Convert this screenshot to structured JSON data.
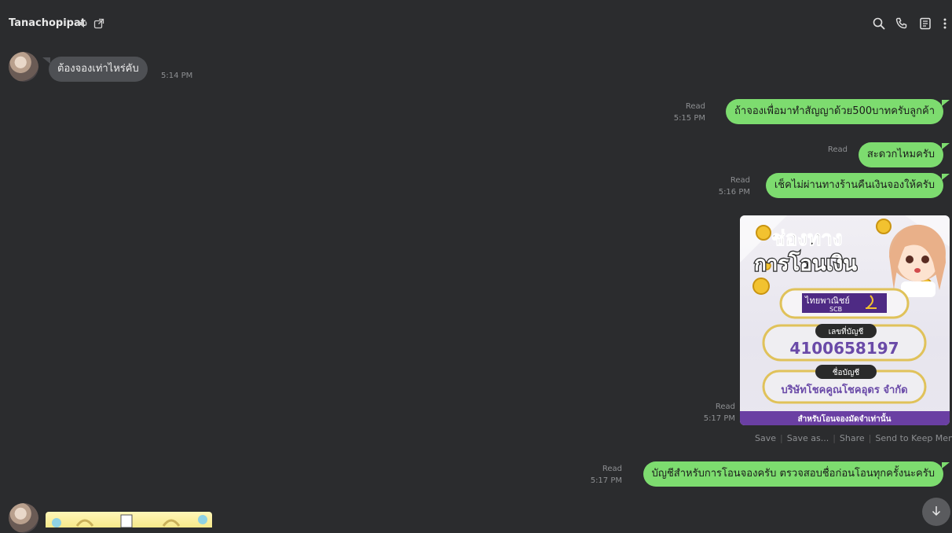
{
  "header": {
    "title": "Tanachopipat"
  },
  "messages": {
    "m1": {
      "text": "ต้องจองเท่าไหร่คับ",
      "time": "5:14 PM"
    },
    "m2": {
      "text": "ถ้าจองเพื่อมาทำสัญญาด้วย500บาทครับลูกค้า",
      "read": "Read",
      "time": "5:15 PM"
    },
    "m3": {
      "text": "สะดวกไหมครับ",
      "read": "Read"
    },
    "m4": {
      "text": "เช็คไม่ผ่านทางร้านคืนเงินจองให้ครับ",
      "read": "Read",
      "time": "5:16 PM"
    },
    "m5": {
      "read": "Read",
      "time": "5:17 PM"
    },
    "m6": {
      "text": "บัญชีสำหรับการโอนจองครับ ตรวจสอบชื่อก่อนโอนทุกครั้งนะครับ",
      "read": "Read",
      "time": "5:17 PM"
    }
  },
  "image": {
    "headline_1": "ช่องทาง",
    "headline_2": "การโอนเงิน",
    "bank_name": "ไทยพาณิชย์",
    "bank_code": "SCB",
    "acct_label": "เลขที่บัญชี",
    "acct_number": "4100658197",
    "name_label": "ชื่อบัญชี",
    "acct_name": "บริษัทโชคคูณโชคอุดร จำกัด",
    "footer": "สำหรับโอนจองมัดจำเท่านั้น"
  },
  "image_actions": {
    "save": "Save",
    "save_as": "Save as...",
    "share": "Share",
    "keep": "Send to Keep Memo"
  },
  "colors": {
    "background": "#2b2c2e",
    "outgoing_bubble": "#7ddc6f",
    "incoming_bubble": "#4e5054",
    "scb_purple": "#4e2a84"
  },
  "icons": [
    "speaker-icon",
    "open-external-icon",
    "search-icon",
    "phone-icon",
    "notes-icon",
    "more-vertical-icon",
    "scroll-down-icon"
  ]
}
